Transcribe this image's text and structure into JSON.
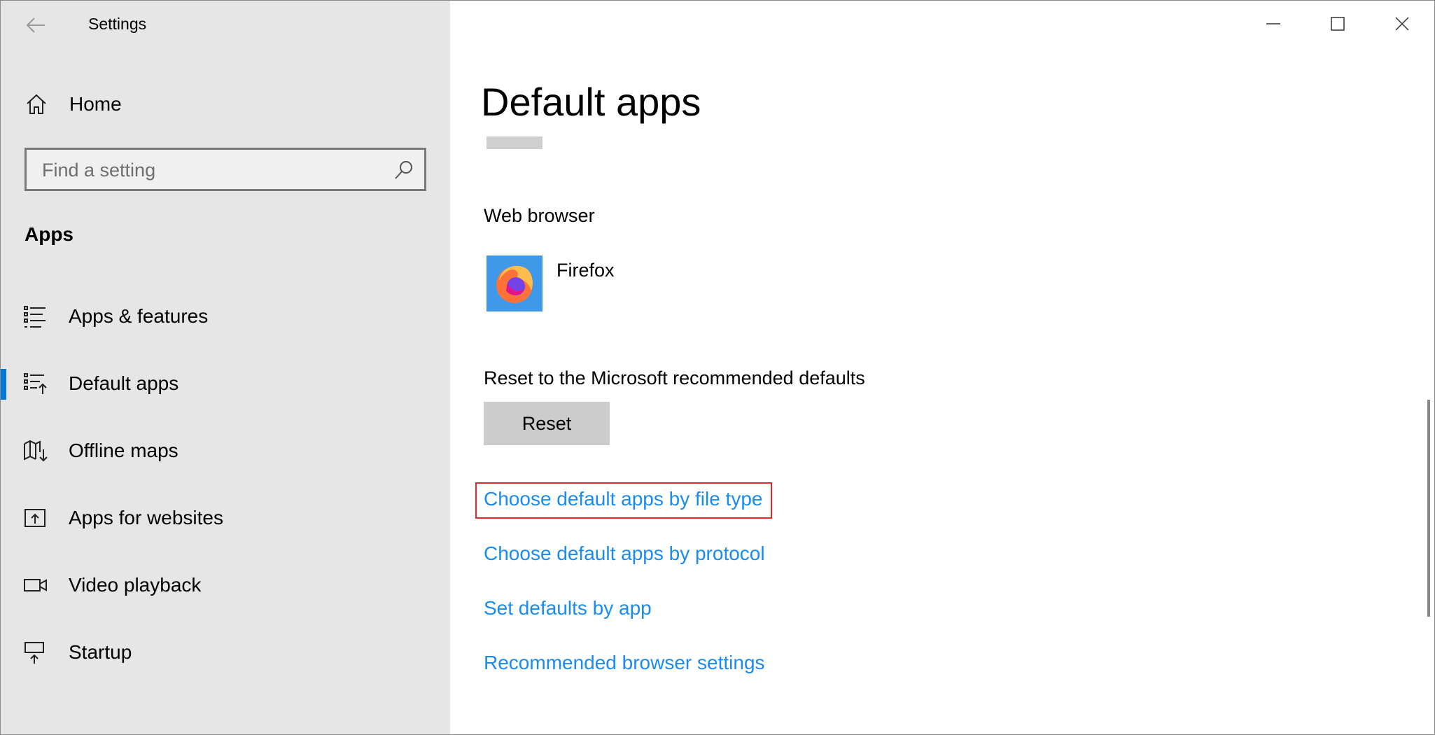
{
  "window": {
    "title": "Settings"
  },
  "sidebar": {
    "home_label": "Home",
    "search_placeholder": "Find a setting",
    "section_title": "Apps",
    "items": [
      {
        "label": "Apps & features",
        "icon": "list-icon",
        "selected": false
      },
      {
        "label": "Default apps",
        "icon": "default-apps-icon",
        "selected": true
      },
      {
        "label": "Offline maps",
        "icon": "map-download-icon",
        "selected": false
      },
      {
        "label": "Apps for websites",
        "icon": "web-link-icon",
        "selected": false
      },
      {
        "label": "Video playback",
        "icon": "video-camera-icon",
        "selected": false
      },
      {
        "label": "Startup",
        "icon": "startup-icon",
        "selected": false
      }
    ]
  },
  "main": {
    "title": "Default apps",
    "web_browser": {
      "label": "Web browser",
      "app_name": "Firefox",
      "icon": "firefox-icon"
    },
    "reset": {
      "label": "Reset to the Microsoft recommended defaults",
      "button_label": "Reset"
    },
    "links": [
      {
        "label": "Choose default apps by file type",
        "highlighted": true
      },
      {
        "label": "Choose default apps by protocol",
        "highlighted": false
      },
      {
        "label": "Set defaults by app",
        "highlighted": false
      },
      {
        "label": "Recommended browser settings",
        "highlighted": false
      }
    ]
  },
  "colors": {
    "accent": "#0078d7",
    "link": "#1a8cf0",
    "highlight_border": "#e8242c",
    "sidebar_bg": "#e6e6e6"
  }
}
